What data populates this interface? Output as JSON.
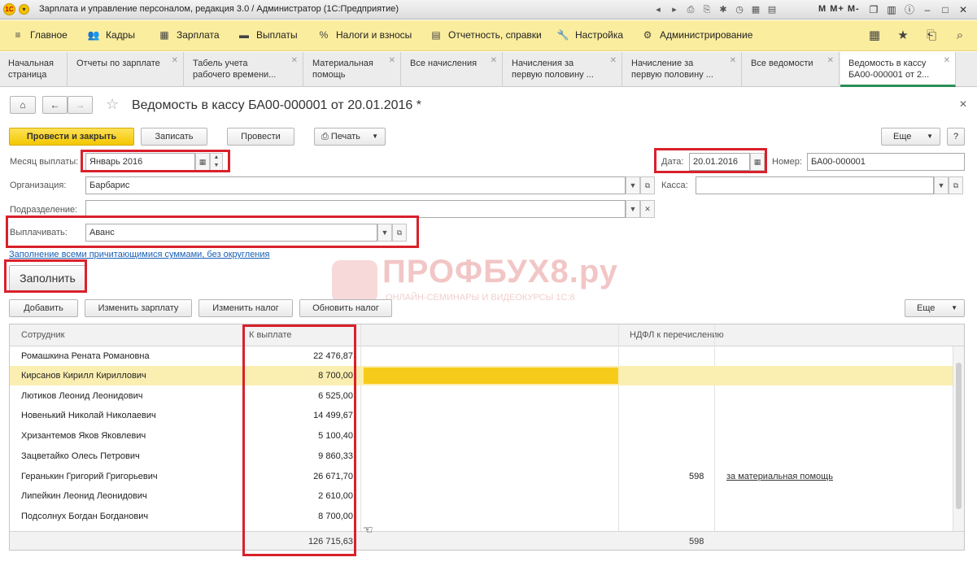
{
  "window": {
    "title": "Зарплата и управление персоналом, редакция 3.0 / Администратор  (1С:Предприятие)",
    "logo_text": "1С",
    "right_letters": "M M+ M-"
  },
  "sections": [
    {
      "label": "Главное",
      "icon": "menu-icon"
    },
    {
      "label": "Кадры",
      "icon": "people-icon"
    },
    {
      "label": "Зарплата",
      "icon": "calculator-icon"
    },
    {
      "label": "Выплаты",
      "icon": "wallet-icon"
    },
    {
      "label": "Налоги и взносы",
      "icon": "percent-icon"
    },
    {
      "label": "Отчетность, справки",
      "icon": "report-icon"
    },
    {
      "label": "Настройка",
      "icon": "wrench-icon"
    },
    {
      "label": "Администрирование",
      "icon": "gear-icon"
    }
  ],
  "open_tabs": [
    {
      "line1": "Начальная",
      "line2": "страница"
    },
    {
      "line1": "Отчеты по зарплате",
      "line2": ""
    },
    {
      "line1": "Табель учета",
      "line2": "рабочего времени..."
    },
    {
      "line1": "Материальная",
      "line2": "помощь"
    },
    {
      "line1": "Все начисления",
      "line2": ""
    },
    {
      "line1": "Начисления за",
      "line2": "первую половину ..."
    },
    {
      "line1": "Начисление за",
      "line2": "первую половину ..."
    },
    {
      "line1": "Все ведомости",
      "line2": ""
    },
    {
      "line1": "Ведомость в кассу",
      "line2": "БА00-000001 от 2..."
    }
  ],
  "doc": {
    "title": "Ведомость в кассу БА00-000001 от 20.01.2016 *",
    "buttons": {
      "post_close": "Провести и закрыть",
      "save": "Записать",
      "post": "Провести",
      "print": "Печать",
      "more": "Еще",
      "help": "?"
    }
  },
  "form": {
    "month_label": "Месяц выплаты:",
    "month_value": "Январь 2016",
    "date_label": "Дата:",
    "date_value": "20.01.2016",
    "number_label": "Номер:",
    "number_value": "БА00-000001",
    "org_label": "Организация:",
    "org_value": "Барбарис",
    "cash_label": "Касса:",
    "cash_value": "",
    "dept_label": "Подразделение:",
    "dept_value": "",
    "pay_label": "Выплачивать:",
    "pay_value": "Аванс",
    "fill_link": "Заполнение всеми причитающимися суммами, без округления",
    "fill_button": "Заполнить"
  },
  "table_toolbar": {
    "add": "Добавить",
    "change_salary": "Изменить зарплату",
    "change_tax": "Изменить налог",
    "refresh_tax": "Обновить налог",
    "more": "Еще"
  },
  "watermark": {
    "text": "ПРОФБУХ8.ру",
    "sub": "ОНЛАЙН-СЕМИНАРЫ И ВИДЕОКУРСЫ 1С:8"
  },
  "table": {
    "headers": {
      "employee": "Сотрудник",
      "amount": "К выплате",
      "ndfl": "НДФЛ к перечислению"
    },
    "rows": [
      {
        "name": "Ромашкина Рената Романовна",
        "amount": "22 476,87",
        "ndfl": "",
        "ndfl_note": ""
      },
      {
        "name": "Кирсанов Кирилл Кириллович",
        "amount": "8 700,00",
        "ndfl": "",
        "ndfl_note": ""
      },
      {
        "name": "Лютиков Леонид Леонидович",
        "amount": "6 525,00",
        "ndfl": "",
        "ndfl_note": ""
      },
      {
        "name": "Новенький Николай Николаевич",
        "amount": "14 499,67",
        "ndfl": "",
        "ndfl_note": ""
      },
      {
        "name": "Хризантемов Яков Яковлевич",
        "amount": "5 100,40",
        "ndfl": "",
        "ndfl_note": ""
      },
      {
        "name": "Зацветайко Олесь Петрович",
        "amount": "9 860,33",
        "ndfl": "",
        "ndfl_note": ""
      },
      {
        "name": "Геранькин Григорий Григорьевич",
        "amount": "26 671,70",
        "ndfl": "598",
        "ndfl_note": "за материальная помощь"
      },
      {
        "name": "Липейкин Леонид Леонидович",
        "amount": "2 610,00",
        "ndfl": "",
        "ndfl_note": ""
      },
      {
        "name": "Подсолнух Богдан Богданович",
        "amount": "8 700,00",
        "ndfl": "",
        "ndfl_note": ""
      }
    ],
    "total_amount": "126 715,63",
    "total_ndfl": "598"
  },
  "colors": {
    "accent_yellow": "#f3c700",
    "highlight_red": "#d9212b",
    "section_bg": "#fbed9e",
    "selected_row": "#fbeeb1"
  }
}
